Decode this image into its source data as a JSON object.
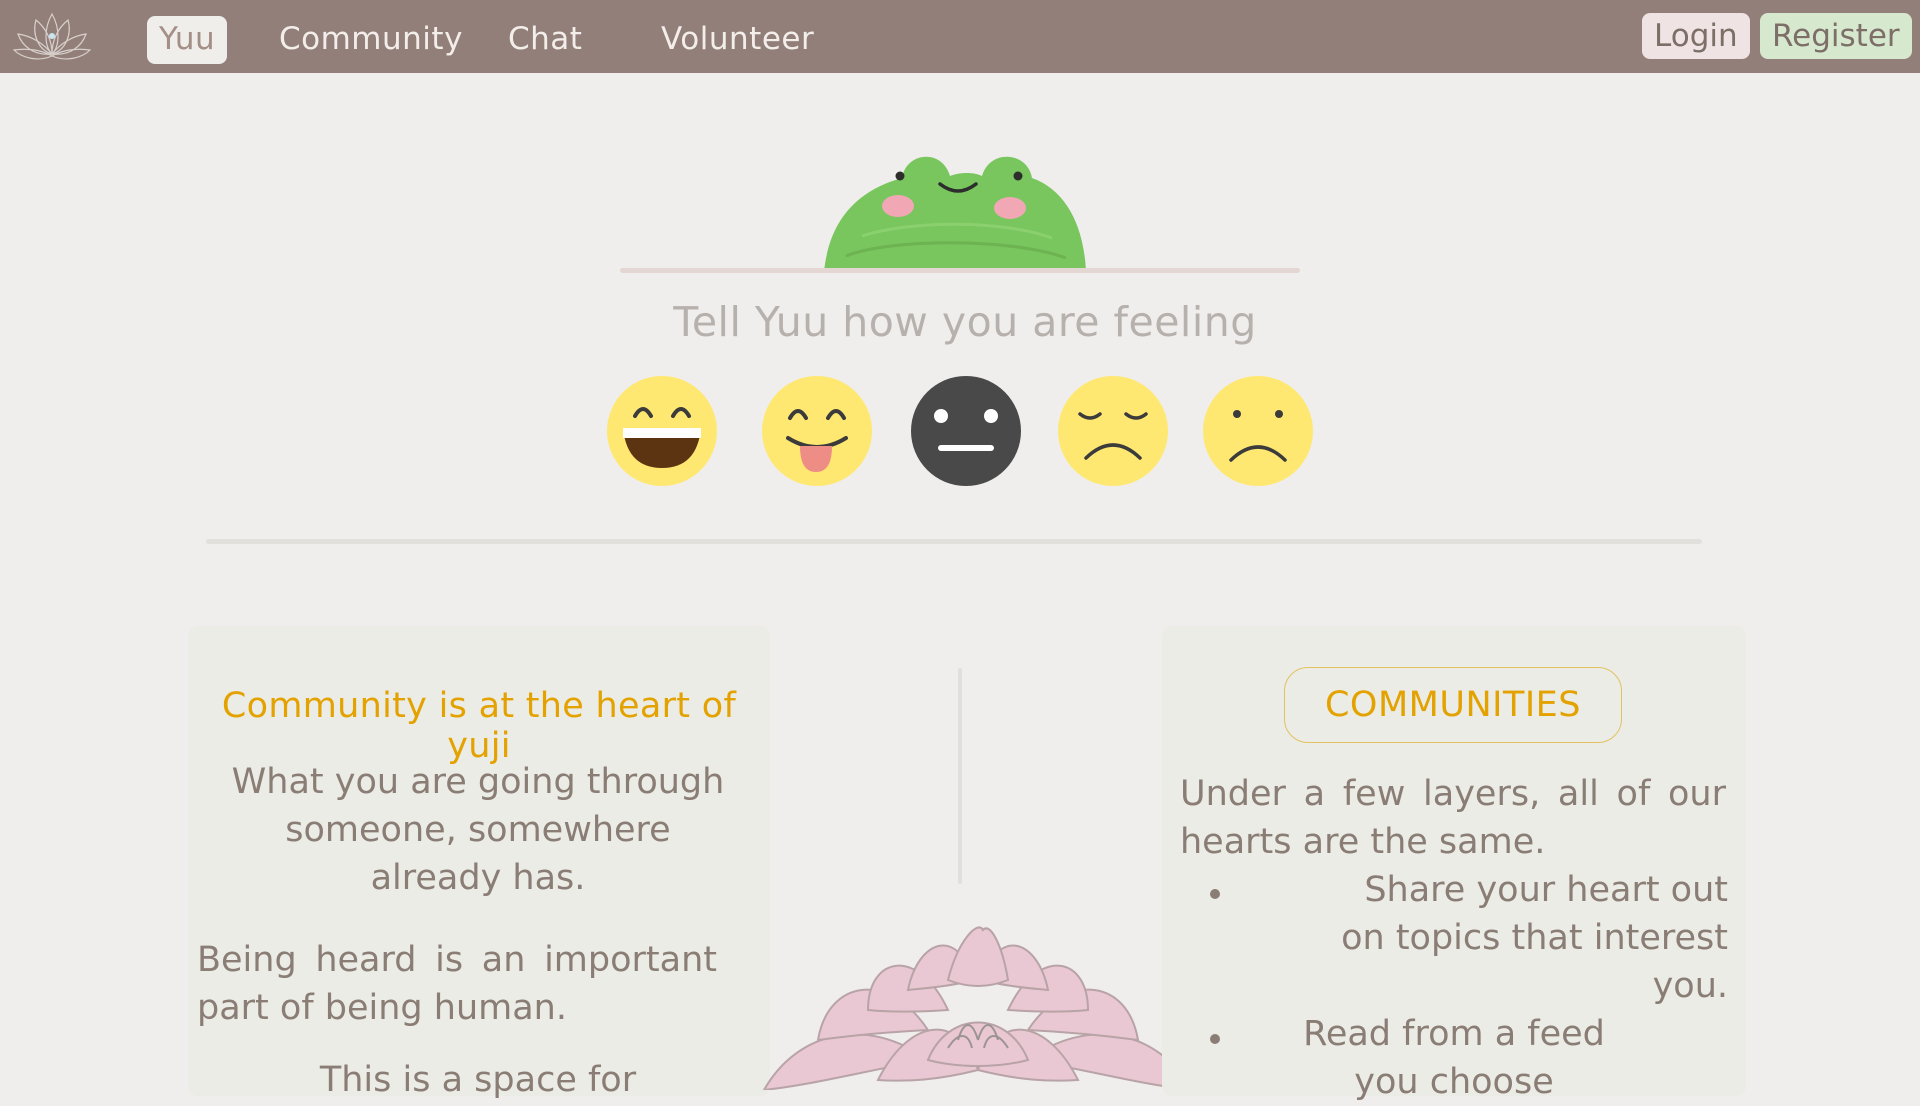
{
  "nav": {
    "links": [
      "Yuu",
      "Community",
      "Chat",
      "Volunteer"
    ],
    "active": "Yuu",
    "login_label": "Login",
    "register_label": "Register",
    "colors": {
      "bar": "#927f7a",
      "active_bg": "#efeeea",
      "login_bg": "#efe3e3",
      "register_bg": "#d6e9cf"
    }
  },
  "mood": {
    "prompt": "Tell Yuu how you are feeling",
    "options": [
      "very-happy-face-icon",
      "happy-tongue-face-icon",
      "neutral-face-icon",
      "sad-face-icon",
      "frown-face-icon"
    ],
    "selected": "neutral-face-icon"
  },
  "community_card": {
    "heading": "Community is at the heart of yuji",
    "para1": "What you are going through someone, somewhere already has.",
    "para2": "Being heard is an important part of being human.",
    "para3": "This is a space for"
  },
  "communities_card": {
    "button_label": "COMMUNITIES",
    "intro": "Under a few layers, all of our hearts are the same.",
    "bullets": [
      "Share your heart out on topics that interest you.",
      "Read from a feed you choose"
    ]
  },
  "accent_color": "#e3a200"
}
